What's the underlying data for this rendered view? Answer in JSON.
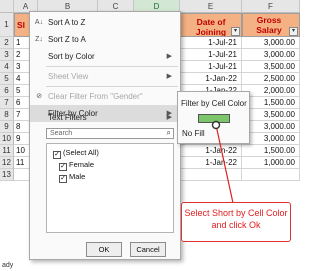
{
  "columns": [
    "A",
    "B",
    "C",
    "D",
    "E",
    "F"
  ],
  "header_row": {
    "a": "Sl",
    "e": "Date of Joining",
    "f": "Gross Salary (USD)"
  },
  "rows": [
    {
      "num": "1",
      "a": "",
      "date": "1-Jul-21",
      "salary": "3,500.00",
      "green": false
    },
    {
      "num": "2",
      "a": "1",
      "date": "1-Jul-21",
      "salary": "3,000.00",
      "green": false
    },
    {
      "num": "3",
      "a": "2",
      "date": "1-Jul-21",
      "salary": "3,000.00",
      "green": true
    },
    {
      "num": "4",
      "a": "3",
      "date": "1-Jul-21",
      "salary": "3,500.00",
      "green": false
    },
    {
      "num": "5",
      "a": "4",
      "date": "1-Jan-22",
      "salary": "2,500.00",
      "green": false
    },
    {
      "num": "6",
      "a": "5",
      "date": "1-Jan-22",
      "salary": "2,000.00",
      "green": false
    },
    {
      "num": "7",
      "a": "6",
      "date": "1-Jan-22",
      "salary": "1,500.00",
      "green": false
    },
    {
      "num": "8",
      "a": "7",
      "date": "1-Jan-22",
      "salary": "3,500.00",
      "green": false
    },
    {
      "num": "9",
      "a": "8",
      "date": "1-Jan-22",
      "salary": "3,000.00",
      "green": false
    },
    {
      "num": "10",
      "a": "9",
      "date": "1-Jan-22",
      "salary": "3,000.00",
      "green": false
    },
    {
      "num": "11",
      "a": "10",
      "date": "1-Jan-22",
      "salary": "1,500.00",
      "green": true
    },
    {
      "num": "12",
      "a": "11",
      "date": "1-Jan-22",
      "salary": "1,000.00",
      "green": false
    },
    {
      "num": "13",
      "a": "",
      "date": "",
      "salary": "",
      "green": false
    }
  ],
  "menu": {
    "items": [
      {
        "label": "Sort A to Z",
        "icon": "sort-az-icon",
        "disabled": false,
        "submenu": false
      },
      {
        "label": "Sort Z to A",
        "icon": "sort-za-icon",
        "disabled": false,
        "submenu": false
      },
      {
        "label": "Sort by Color",
        "icon": "",
        "disabled": false,
        "submenu": true
      },
      {
        "label": "Sheet View",
        "icon": "",
        "disabled": true,
        "submenu": true
      },
      {
        "label": "Clear Filter From \"Gender\"",
        "icon": "clear-filter-icon",
        "disabled": true,
        "submenu": false
      },
      {
        "label": "Filter by Color",
        "icon": "",
        "disabled": false,
        "submenu": true,
        "highlighted": true
      },
      {
        "label": "Text Filters",
        "icon": "",
        "disabled": false,
        "submenu": true
      }
    ],
    "search_placeholder": "Search",
    "checklist": [
      {
        "label": "(Select All)",
        "checked": true
      },
      {
        "label": "Female",
        "checked": true
      },
      {
        "label": "Male",
        "checked": true
      }
    ],
    "ok_label": "OK",
    "cancel_label": "Cancel"
  },
  "submenu": {
    "title": "Filter by Cell Color",
    "swatch_color": "#7cc56b",
    "no_fill_label": "No Fill"
  },
  "callout": {
    "text": "Select Short by Cell Color and click Ok",
    "color": "#e02020"
  },
  "status_bar": {
    "text": "ady"
  }
}
